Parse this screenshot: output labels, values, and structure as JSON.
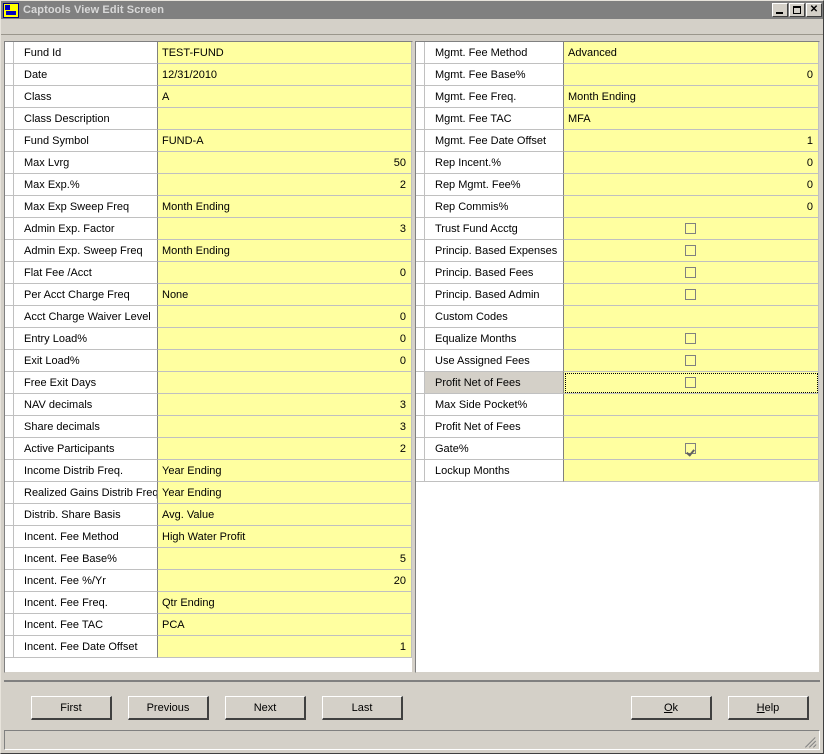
{
  "window": {
    "title": "Captools View Edit Screen",
    "icon": "app-icon",
    "minimize_label": "_",
    "maximize_label": "□",
    "close_label": "✕"
  },
  "colors": {
    "field_background": "#ffffa0",
    "label_background": "#ffffff",
    "selected_label_background": "#d4d0c8",
    "window_chrome": "#d4d0c8",
    "title_bar": "#808080",
    "title_text": "#d8d8d8",
    "grid_line": "#c0c0c0",
    "divider": "#808080"
  },
  "left_grid": {
    "rows": [
      {
        "label": "Fund Id",
        "value": "TEST-FUND",
        "type": "text",
        "align": "left"
      },
      {
        "label": "Date",
        "value": "12/31/2010",
        "type": "text",
        "align": "left"
      },
      {
        "label": "Class",
        "value": "A",
        "type": "text",
        "align": "left"
      },
      {
        "label": "Class Description",
        "value": "",
        "type": "text",
        "align": "left"
      },
      {
        "label": "Fund Symbol",
        "value": "FUND-A",
        "type": "text",
        "align": "left"
      },
      {
        "label": "Max Lvrg",
        "value": "50",
        "type": "number",
        "align": "right"
      },
      {
        "label": "Max Exp.%",
        "value": "2",
        "type": "number",
        "align": "right"
      },
      {
        "label": "Max Exp Sweep Freq",
        "value": "Month Ending",
        "type": "text",
        "align": "left"
      },
      {
        "label": "Admin Exp. Factor",
        "value": "3",
        "type": "number",
        "align": "right"
      },
      {
        "label": "Admin Exp. Sweep Freq",
        "value": "Month Ending",
        "type": "text",
        "align": "left"
      },
      {
        "label": "Flat Fee /Acct",
        "value": "0",
        "type": "number",
        "align": "right"
      },
      {
        "label": "Per Acct Charge Freq",
        "value": "None",
        "type": "text",
        "align": "left"
      },
      {
        "label": "Acct Charge Waiver Level",
        "value": "0",
        "type": "number",
        "align": "right"
      },
      {
        "label": "Entry Load%",
        "value": "0",
        "type": "number",
        "align": "right"
      },
      {
        "label": "Exit Load%",
        "value": "0",
        "type": "number",
        "align": "right"
      },
      {
        "label": "Free Exit Days",
        "value": "",
        "type": "text",
        "align": "left"
      },
      {
        "label": "NAV decimals",
        "value": "3",
        "type": "number",
        "align": "right"
      },
      {
        "label": "Share decimals",
        "value": "3",
        "type": "number",
        "align": "right"
      },
      {
        "label": "Active Participants",
        "value": "2",
        "type": "number",
        "align": "right"
      },
      {
        "label": "Income Distrib Freq.",
        "value": "Year Ending",
        "type": "text",
        "align": "left"
      },
      {
        "label": "Realized Gains Distrib Freq.",
        "value": "Year Ending",
        "type": "text",
        "align": "left"
      },
      {
        "label": "Distrib. Share Basis",
        "value": "Avg. Value",
        "type": "text",
        "align": "left"
      },
      {
        "label": "Incent. Fee Method",
        "value": "High Water Profit",
        "type": "text",
        "align": "left"
      },
      {
        "label": "Incent. Fee Base%",
        "value": "5",
        "type": "number",
        "align": "right"
      },
      {
        "label": "Incent. Fee %/Yr",
        "value": "20",
        "type": "number",
        "align": "right"
      },
      {
        "label": "Incent. Fee Freq.",
        "value": "Qtr Ending",
        "type": "text",
        "align": "left"
      },
      {
        "label": "Incent. Fee TAC",
        "value": "PCA",
        "type": "text",
        "align": "left"
      },
      {
        "label": "Incent. Fee Date Offset",
        "value": "1",
        "type": "number",
        "align": "right"
      }
    ]
  },
  "right_grid": {
    "rows": [
      {
        "label": "Mgmt. Fee Method",
        "value": "Advanced",
        "type": "text",
        "align": "left"
      },
      {
        "label": "Mgmt. Fee Base%",
        "value": "0",
        "type": "number",
        "align": "right"
      },
      {
        "label": "Mgmt. Fee Freq.",
        "value": "Month Ending",
        "type": "text",
        "align": "left"
      },
      {
        "label": "Mgmt. Fee TAC",
        "value": "MFA",
        "type": "text",
        "align": "left"
      },
      {
        "label": "Mgmt. Fee Date Offset",
        "value": "1",
        "type": "number",
        "align": "right"
      },
      {
        "label": "Rep Incent.%",
        "value": "0",
        "type": "number",
        "align": "right"
      },
      {
        "label": "Rep Mgmt. Fee%",
        "value": "0",
        "type": "number",
        "align": "right"
      },
      {
        "label": "Rep Commis%",
        "value": "0",
        "type": "number",
        "align": "right"
      },
      {
        "label": "Trust Fund Acctg",
        "value": "",
        "type": "checkbox",
        "checked": false
      },
      {
        "label": "Princip. Based Expenses",
        "value": "",
        "type": "checkbox",
        "checked": false
      },
      {
        "label": "Princip. Based Fees",
        "value": "",
        "type": "checkbox",
        "checked": false
      },
      {
        "label": "Princip. Based Admin",
        "value": "",
        "type": "checkbox",
        "checked": false
      },
      {
        "label": "Custom Codes",
        "value": "",
        "type": "text",
        "align": "left"
      },
      {
        "label": "Equalize Months",
        "value": "",
        "type": "checkbox",
        "checked": false
      },
      {
        "label": "Use Assigned Fees",
        "value": "",
        "type": "checkbox",
        "checked": false
      },
      {
        "label": "Profit Net of Fees",
        "value": "",
        "type": "checkbox",
        "checked": false,
        "selected": true
      },
      {
        "label": "Max Side Pocket%",
        "value": "",
        "type": "text",
        "align": "left"
      },
      {
        "label": "Profit Net of Fees",
        "value": "",
        "type": "text",
        "align": "left"
      },
      {
        "label": "Gate%",
        "value": "",
        "type": "checkbox",
        "checked": true
      },
      {
        "label": "Lockup Months",
        "value": "",
        "type": "text",
        "align": "left"
      }
    ]
  },
  "buttons": {
    "first": "First",
    "previous": "Previous",
    "next": "Next",
    "last": "Last",
    "ok": {
      "accel": "O",
      "rest": "k"
    },
    "help": {
      "accel": "H",
      "rest": "elp"
    }
  },
  "status_bar": {
    "text": ""
  }
}
